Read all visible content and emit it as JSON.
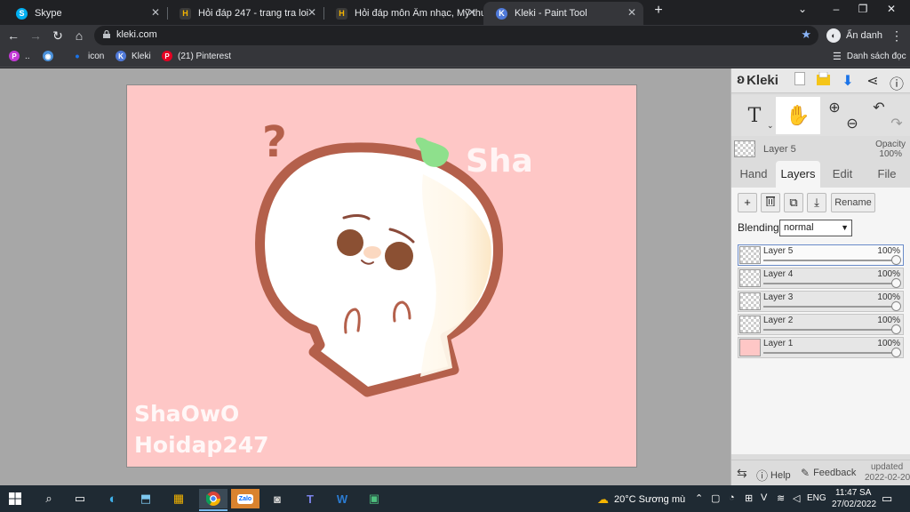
{
  "browser": {
    "tabs": [
      {
        "title": "Skype",
        "icon": "skype-icon",
        "color": "#00aff0",
        "glyph": "S"
      },
      {
        "title": "Hỏi đáp 247 - trang tra loi",
        "icon": "hoidap-icon",
        "color": "#f4b400",
        "glyph": "H"
      },
      {
        "title": "Hỏi đáp môn Âm nhạc, Mỹ thuật...",
        "icon": "hoidap-icon",
        "color": "#f4b400",
        "glyph": "H"
      },
      {
        "title": "Kleki - Paint Tool",
        "icon": "kleki-icon",
        "color": "#4f79d8",
        "glyph": "K"
      }
    ],
    "new_tab": "+",
    "window_controls": {
      "dropdown": "⌄",
      "minimize": "–",
      "restore": "❐",
      "close": "✕"
    },
    "url": "kleki.com",
    "profile_label": "Ẩn danh",
    "bookmarks": [
      {
        "label": "..",
        "icon": "picsart-icon",
        "color": "#c43ad6",
        "glyph": "P"
      },
      {
        "label": "",
        "icon": "globe-icon",
        "color": "#4a90d9",
        "glyph": "◉"
      },
      {
        "label": "icon",
        "icon": "dot-icon",
        "color": "#1a73e8",
        "glyph": "•"
      },
      {
        "label": "Kleki",
        "icon": "kleki-icon",
        "color": "#4f79d8",
        "glyph": "K"
      },
      {
        "label": "(21) Pinterest",
        "icon": "pinterest-icon",
        "color": "#e60023",
        "glyph": "P"
      }
    ],
    "reading_list": "Danh sách đọc"
  },
  "canvas": {
    "question_mark": "?",
    "watermark_top": "Sha",
    "watermark_line1": "ShaOwO",
    "watermark_line2": "Hoidap247",
    "background_color": "#fec7c6",
    "outline_color": "#b4604b"
  },
  "panel": {
    "logo": "Kleki",
    "tools": {
      "text": "T",
      "hand": "✋",
      "zoom_in": "⊕",
      "zoom_out": "⊖",
      "undo": "↶",
      "redo": "↷"
    },
    "current_layer": {
      "name": "Layer 5",
      "opacity_label": "Opacity",
      "opacity_value": "100%"
    },
    "tabs": [
      {
        "label": "Hand",
        "active": false
      },
      {
        "label": "Layers",
        "active": true
      },
      {
        "label": "Edit",
        "active": false
      },
      {
        "label": "File",
        "active": false
      }
    ],
    "layer_buttons": {
      "add": "+",
      "delete": "🗑",
      "duplicate": "⧉",
      "merge": "⤓",
      "rename": "Rename"
    },
    "blending_label": "Blending",
    "blending_value": "normal",
    "layers": [
      {
        "name": "Layer 5",
        "opacity": "100%",
        "selected": true
      },
      {
        "name": "Layer 4",
        "opacity": "100%",
        "selected": false
      },
      {
        "name": "Layer 3",
        "opacity": "100%",
        "selected": false
      },
      {
        "name": "Layer 2",
        "opacity": "100%",
        "selected": false
      },
      {
        "name": "Layer 1",
        "opacity": "100%",
        "selected": false
      }
    ],
    "footer": {
      "help": "Help",
      "feedback": "Feedback",
      "updated_label": "updated",
      "updated_date": "2022-02-20"
    }
  },
  "taskbar": {
    "weather": "20°C  Sương mù",
    "language": "ENG",
    "time": "11:47 SA",
    "date": "27/02/2022"
  }
}
